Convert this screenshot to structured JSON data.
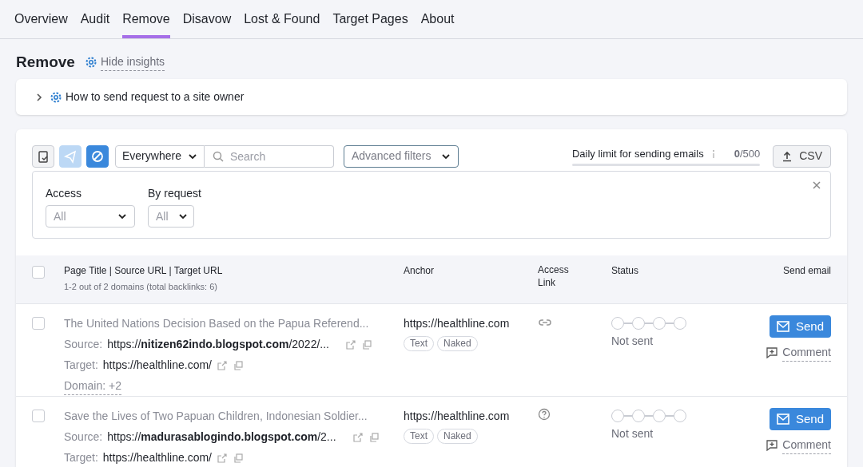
{
  "tabs": [
    {
      "label": "Overview",
      "selected": false
    },
    {
      "label": "Audit",
      "selected": false
    },
    {
      "label": "Remove",
      "selected": true
    },
    {
      "label": "Disavow",
      "selected": false
    },
    {
      "label": "Lost & Found",
      "selected": false
    },
    {
      "label": "Target Pages",
      "selected": false
    },
    {
      "label": "About",
      "selected": false
    }
  ],
  "page_title": "Remove",
  "insights_link": "Hide insights",
  "insight": {
    "text": "How to send request to a site owner",
    "expanded": false
  },
  "toolbar": {
    "icon_buttons": [
      {
        "kind": "export",
        "disabled": false,
        "active": false
      },
      {
        "kind": "send",
        "disabled": true,
        "active": false
      },
      {
        "kind": "block",
        "disabled": false,
        "active": true
      }
    ],
    "scope": "Everywhere",
    "search": {
      "placeholder": "Search"
    },
    "advanced_filters": "Advanced filters",
    "daily_limit": {
      "label": "Daily limit for sending emails",
      "count": "**0**/500",
      "level": 0
    },
    "csv_button": "CSV"
  },
  "filters": [
    {
      "label": "Access",
      "value": "All"
    },
    {
      "label": "By request",
      "value": "All"
    }
  ],
  "table": {
    "columns": [
      {
        "title": "Page Title | Source URL | Target URL",
        "subtitle": "1-2 out of 2 domains (total backlinks: 6)"
      },
      {
        "title": "Anchor"
      },
      {
        "title": "Access Link"
      },
      {
        "title": "Status"
      },
      {
        "title": "Send email"
      }
    ],
    "header_checked": false,
    "rows": [
      {
        "checked": false,
        "title": "The United Nations Decision Based on the Papua Referend...",
        "source_label": "Source:",
        "source": "https://**nitizen62indo.blogspot.com**/2022/...",
        "target_label": "Target:",
        "target": "https://healthline.com/",
        "domain": "Domain: +2",
        "anchor": "https://healthline.com",
        "tags": [
          "Text",
          "Naked"
        ],
        "access": {
          "kind": "link"
        },
        "steps": [
          {
            "done": false
          },
          {
            "done": false
          },
          {
            "done": false
          },
          {
            "done": false
          }
        ],
        "status": "Not sent",
        "send": "Send",
        "comment": "Comment"
      },
      {
        "checked": false,
        "title": "Save the Lives of Two Papuan Children, Indonesian Soldier...",
        "source_label": "Source:",
        "source": "https://**madurasablogindo.blogspot.com**/2...",
        "target_label": "Target:",
        "target": "https://healthline.com/",
        "anchor": "https://healthline.com",
        "tags": [
          "Text",
          "Naked"
        ],
        "access": {
          "kind": "unknown"
        },
        "steps": [
          {
            "done": false
          },
          {
            "done": false
          },
          {
            "done": false
          },
          {
            "done": false
          }
        ],
        "status": "Not sent",
        "send": "Send",
        "comment": "Comment"
      }
    ]
  }
}
